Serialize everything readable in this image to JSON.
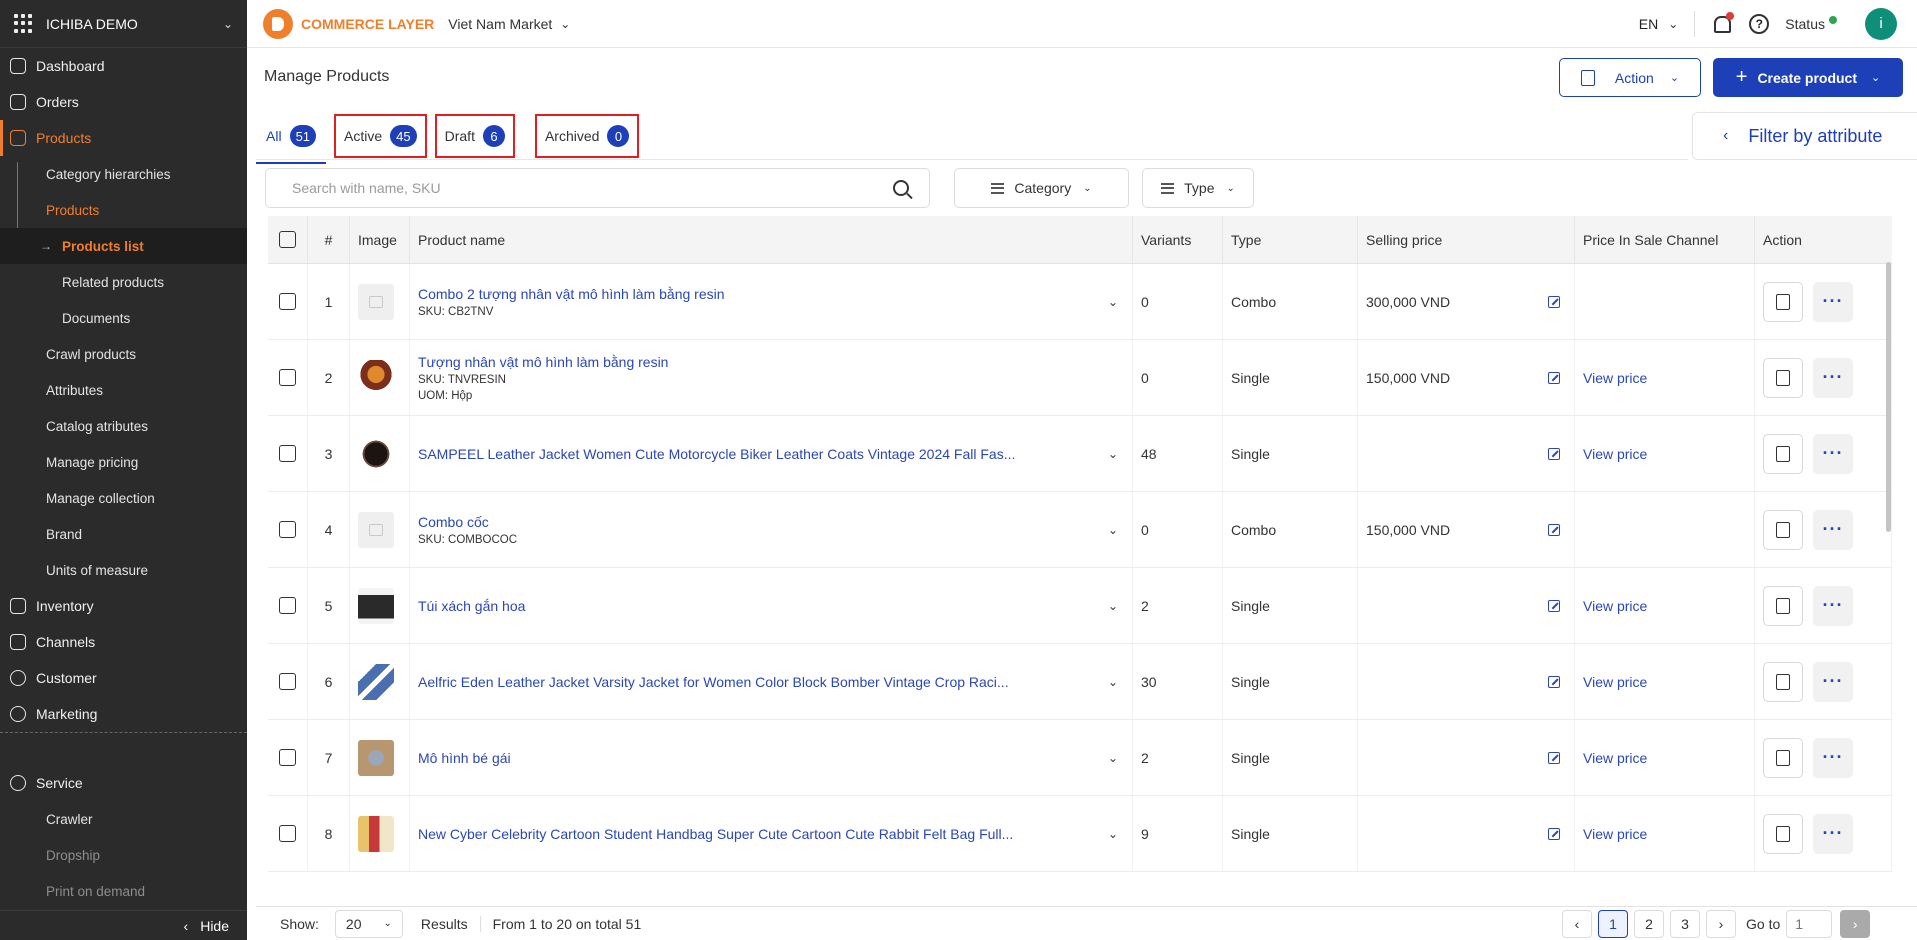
{
  "sidebar": {
    "workspace": "ICHIBA DEMO",
    "items": {
      "dashboard": "Dashboard",
      "orders": "Orders",
      "products": "Products",
      "inventory": "Inventory",
      "channels": "Channels",
      "customer": "Customer",
      "marketing": "Marketing",
      "service": "Service"
    },
    "products_sub": {
      "category_hierarchies": "Category hierarchies",
      "products": "Products",
      "products_list": "Products list",
      "related_products": "Related products",
      "documents": "Documents",
      "crawl_products": "Crawl products",
      "attributes": "Attributes",
      "catalog_atributes": "Catalog atributes",
      "manage_pricing": "Manage pricing",
      "manage_collection": "Manage collection",
      "brand": "Brand",
      "units_of_measure": "Units of measure"
    },
    "service_sub": {
      "crawler": "Crawler",
      "dropship": "Dropship",
      "print_on_demand": "Print on demand"
    },
    "hide_label": "Hide"
  },
  "topbar": {
    "brand": "COMMERCE LAYER",
    "market": "Viet Nam Market",
    "language": "EN",
    "status": "Status",
    "avatar_initial": "i"
  },
  "header": {
    "title": "Manage Products",
    "action_label": "Action",
    "create_label": "Create product"
  },
  "tabs": [
    {
      "label": "All",
      "count": "51"
    },
    {
      "label": "Active",
      "count": "45"
    },
    {
      "label": "Draft",
      "count": "6"
    },
    {
      "label": "Archived",
      "count": "0"
    }
  ],
  "filter_by_attribute": "Filter by attribute",
  "filters": {
    "search_placeholder": "Search with name, SKU",
    "category": "Category",
    "type": "Type"
  },
  "table": {
    "columns": {
      "num": "#",
      "image": "Image",
      "name": "Product name",
      "variants": "Variants",
      "type": "Type",
      "selling_price": "Selling price",
      "channel_price": "Price In Sale Channel",
      "action": "Action"
    },
    "rows": [
      {
        "num": "1",
        "name": "Combo 2 tượng nhân vật mô hình làm bằng resin",
        "sku": "SKU: CB2TNV",
        "uom": "",
        "variants": "0",
        "type": "Combo",
        "price": "300,000 VND",
        "channel": ""
      },
      {
        "num": "2",
        "name": "Tượng nhân vật mô hình làm bằng resin",
        "sku": "SKU: TNVRESIN",
        "uom": "UOM: Hộp",
        "variants": "0",
        "type": "Single",
        "price": "150,000 VND",
        "channel": "View price"
      },
      {
        "num": "3",
        "name": "SAMPEEL Leather Jacket Women Cute Motorcycle Biker Leather Coats Vintage 2024 Fall Fas...",
        "sku": "",
        "uom": "",
        "variants": "48",
        "type": "Single",
        "price": "",
        "channel": "View price"
      },
      {
        "num": "4",
        "name": "Combo cốc",
        "sku": "SKU: COMBOCOC",
        "uom": "",
        "variants": "0",
        "type": "Combo",
        "price": "150,000 VND",
        "channel": ""
      },
      {
        "num": "5",
        "name": "Túi xách gắn hoa",
        "sku": "",
        "uom": "",
        "variants": "2",
        "type": "Single",
        "price": "",
        "channel": "View price"
      },
      {
        "num": "6",
        "name": "Aelfric Eden Leather Jacket Varsity Jacket for Women Color Block Bomber Vintage Crop Raci...",
        "sku": "",
        "uom": "",
        "variants": "30",
        "type": "Single",
        "price": "",
        "channel": "View price"
      },
      {
        "num": "7",
        "name": "Mô hình bé gái",
        "sku": "",
        "uom": "",
        "variants": "2",
        "type": "Single",
        "price": "",
        "channel": "View price"
      },
      {
        "num": "8",
        "name": "New Cyber Celebrity Cartoon Student Handbag Super Cute Cartoon Cute Rabbit Felt Bag Full...",
        "sku": "",
        "uom": "",
        "variants": "9",
        "type": "Single",
        "price": "",
        "channel": "View price"
      }
    ]
  },
  "footer": {
    "show_label": "Show:",
    "page_size": "20",
    "results_label": "Results",
    "range_text": "From 1 to 20 on total 51",
    "pages": [
      "1",
      "2",
      "3"
    ],
    "goto_label": "Go to",
    "goto_placeholder": "1"
  },
  "colors": {
    "accent": "#1d3fb8",
    "brand_orange": "#f07f2d",
    "sidebar_bg": "#2b2b2b"
  }
}
